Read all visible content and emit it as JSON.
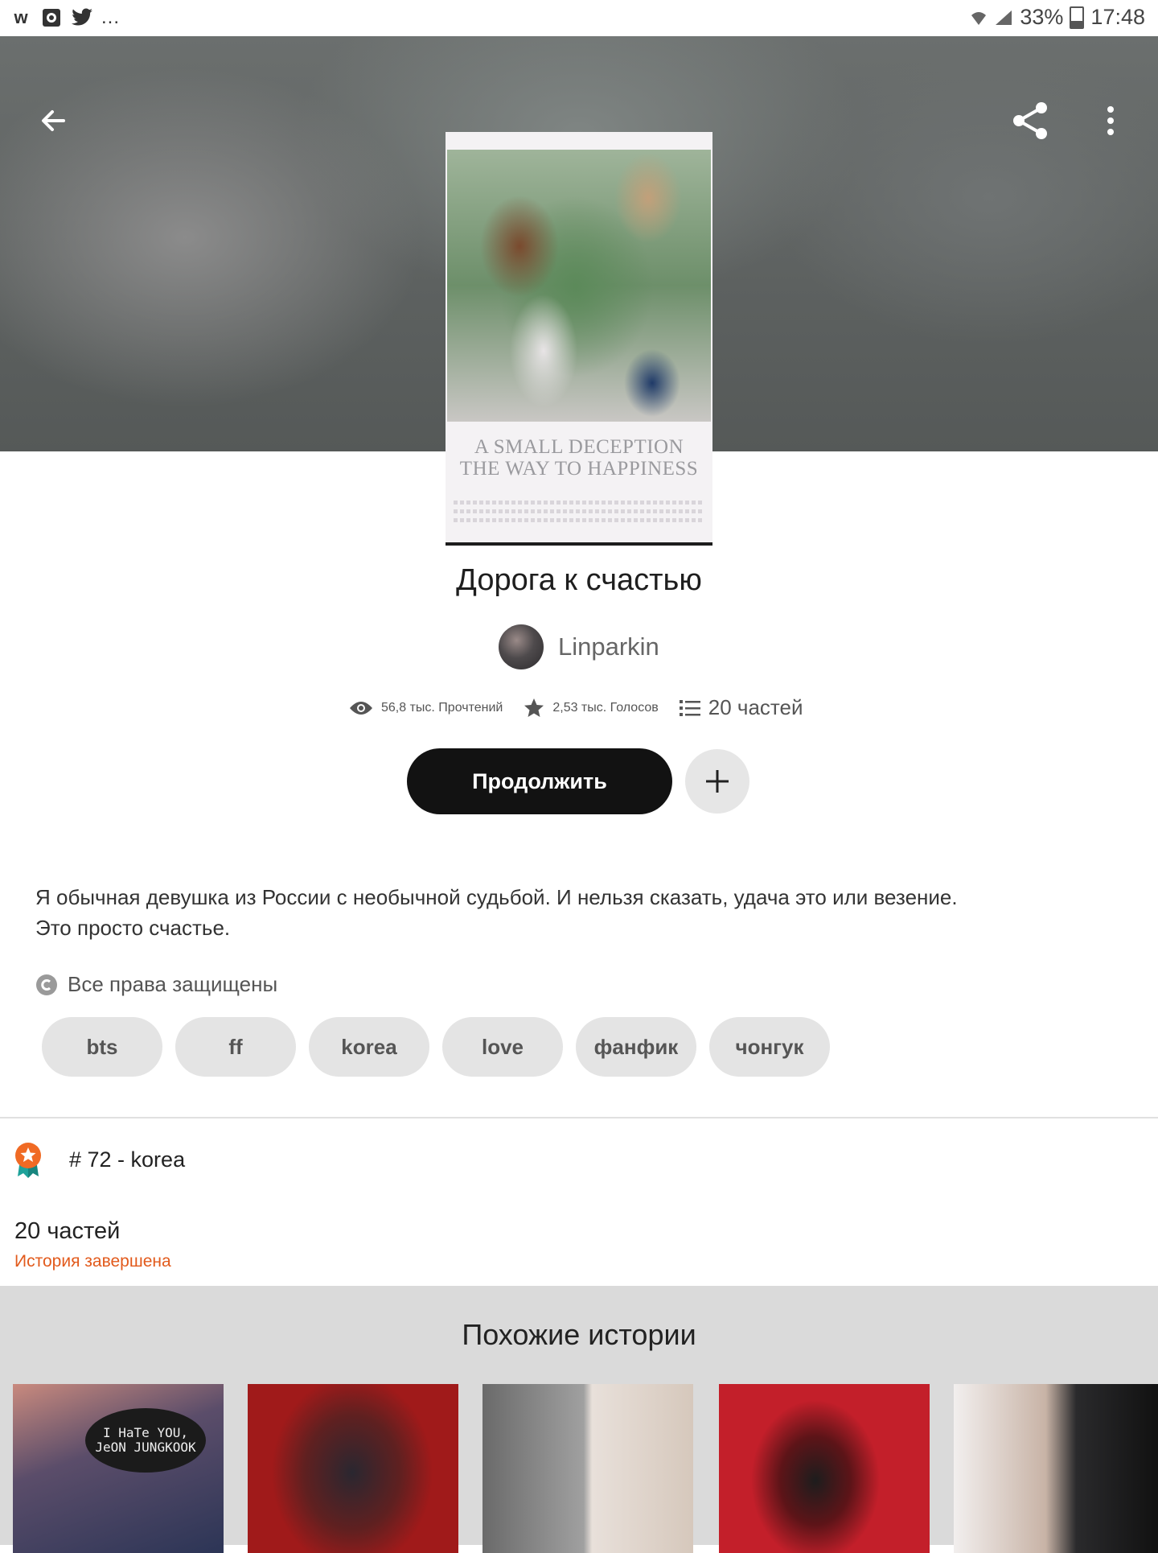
{
  "status_bar": {
    "left_icons": [
      "wattpad-icon",
      "photo-icon",
      "twitter-icon"
    ],
    "more": "...",
    "battery": "33%",
    "time": "17:48"
  },
  "header": {
    "back_icon": "arrow-left-icon",
    "share_icon": "share-icon",
    "more_icon": "more-vertical-icon"
  },
  "cover": {
    "line1": "A SMALL DECEPTION",
    "line2": "THE WAY TO HAPPINESS"
  },
  "story": {
    "title": "Дорога к счастью",
    "author": "Linparkin",
    "reads": "56,8 тыс. Прочтений",
    "votes": "2,53 тыс. Голосов",
    "parts": "20 частей",
    "continue_label": "Продолжить",
    "description": "Я обычная девушка из России с необычной судьбой. И нельзя сказать, удача это или везение.\n Это просто счастье.",
    "copyright": "Все права защищены",
    "tags": [
      "bts",
      "ff",
      "korea",
      "love",
      "фанфик",
      "чонгук"
    ]
  },
  "ranking": {
    "text": "# 72 - korea"
  },
  "parts_section": {
    "count": "20 частей",
    "status": "История завершена"
  },
  "similar": {
    "title": "Похожие истории",
    "first_bubble": "I HaTe YOU, JeON JUNGKOOK"
  },
  "colors": {
    "accent": "#e25a1c",
    "button": "#121212",
    "tag_bg": "#e4e4e4"
  }
}
